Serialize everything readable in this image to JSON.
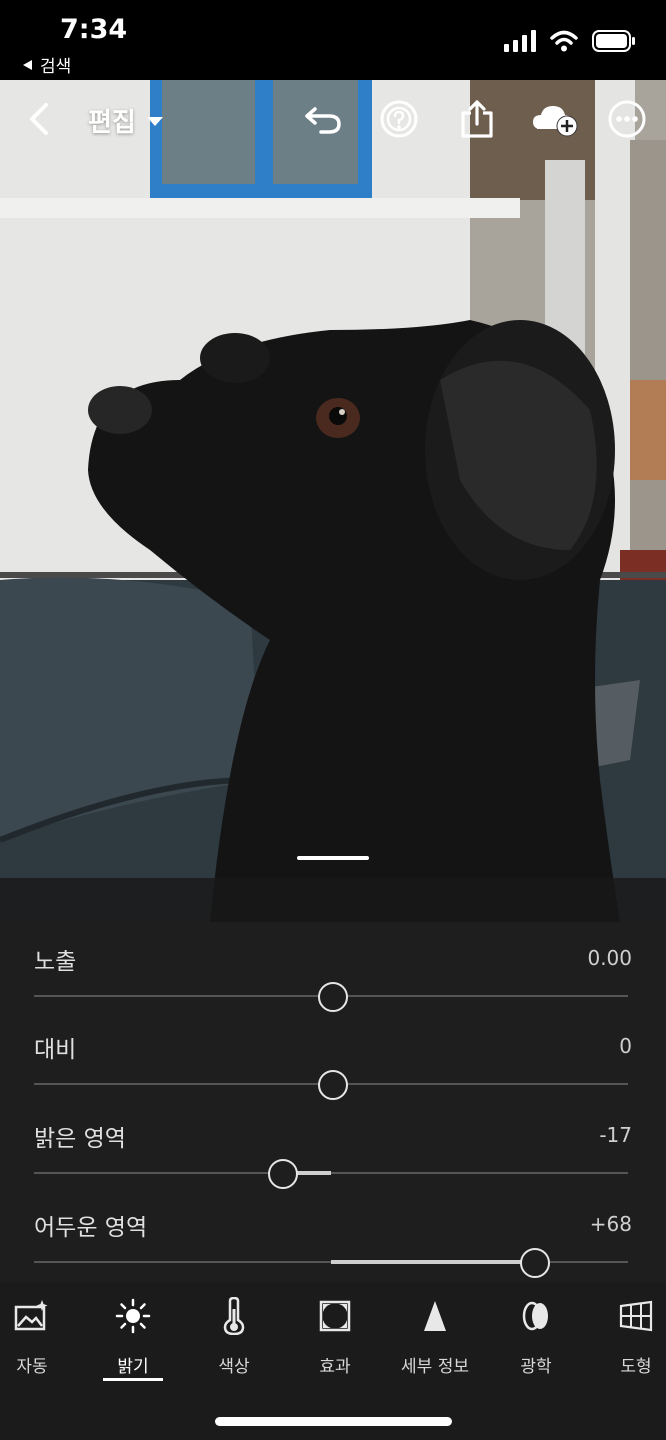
{
  "status_bar": {
    "time": "7:34",
    "back_label": "검색",
    "back_icon": "back-triangle-icon",
    "icons": [
      "signal-icon",
      "wifi-icon",
      "battery-icon"
    ]
  },
  "toolbar": {
    "edit_label": "편집",
    "icons": [
      "back-chevron-icon",
      "dropdown-icon",
      "undo-icon",
      "help-icon",
      "share-icon",
      "cloud-add-icon",
      "more-icon"
    ]
  },
  "sliders": [
    {
      "label": "노출",
      "value_text": "0.00",
      "value": 0,
      "min": -5,
      "max": 5
    },
    {
      "label": "대비",
      "value_text": "0",
      "value": 0,
      "min": -100,
      "max": 100
    },
    {
      "label": "밝은 영역",
      "value_text": "-17",
      "value": -17,
      "min": -100,
      "max": 100
    },
    {
      "label": "어두운 영역",
      "value_text": "+68",
      "value": 68,
      "min": -100,
      "max": 100
    }
  ],
  "tools": [
    {
      "label": "자동",
      "icon": "auto-icon",
      "active": false
    },
    {
      "label": "밝기",
      "icon": "light-icon",
      "active": true
    },
    {
      "label": "색상",
      "icon": "thermometer-icon",
      "active": false
    },
    {
      "label": "효과",
      "icon": "vignette-icon",
      "active": false
    },
    {
      "label": "세부 정보",
      "icon": "detail-icon",
      "active": false
    },
    {
      "label": "광학",
      "icon": "lens-icon",
      "active": false
    },
    {
      "label": "도형",
      "icon": "geometry-icon",
      "active": false
    }
  ],
  "colors": {
    "panel_bg": "#1e1e1e",
    "track": "#555555",
    "fill": "#cfcfcf",
    "photo_blue_frame": "#2f7fc8"
  }
}
